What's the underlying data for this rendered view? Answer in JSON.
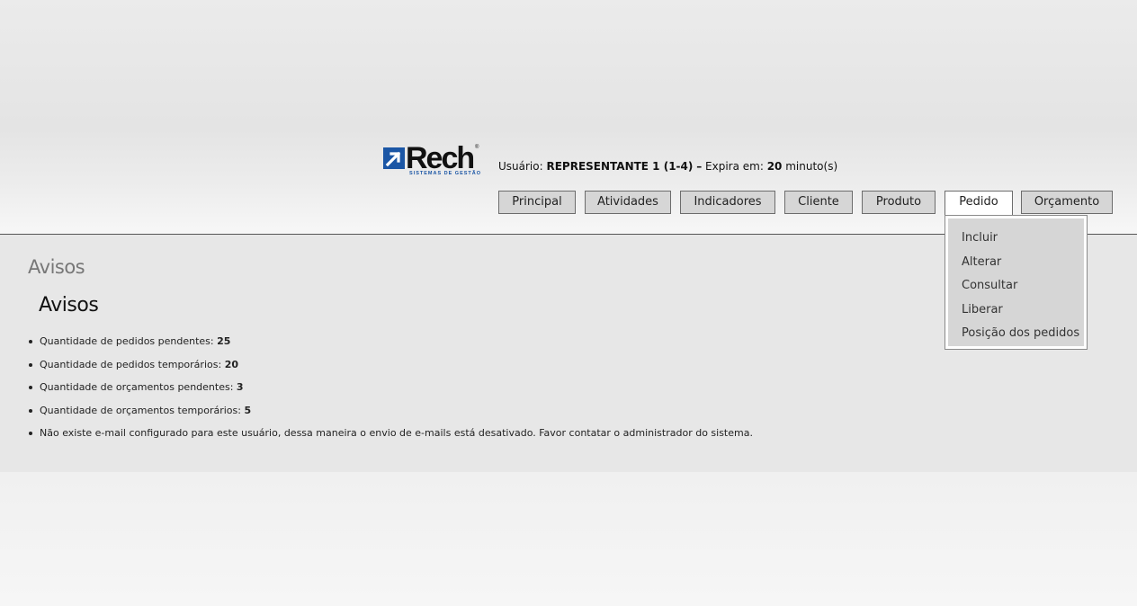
{
  "logo": {
    "wordmark": "Rech",
    "registered": "®",
    "tagline": "SISTEMAS DE GESTÃO"
  },
  "user_info": {
    "user_label": "Usuário:",
    "user_name": "REPRESENTANTE 1 (1-4)",
    "separator": "–",
    "expires_label": "Expira em:",
    "expires_value": "20",
    "expires_unit": "minuto(s)"
  },
  "nav": {
    "items": [
      {
        "label": "Principal"
      },
      {
        "label": "Atividades"
      },
      {
        "label": "Indicadores"
      },
      {
        "label": "Cliente"
      },
      {
        "label": "Produto"
      },
      {
        "label": "Pedido"
      },
      {
        "label": "Orçamento"
      }
    ],
    "active": "Pedido"
  },
  "dropdown": {
    "items": [
      {
        "label": "Incluir"
      },
      {
        "label": "Alterar"
      },
      {
        "label": "Consultar"
      },
      {
        "label": "Liberar"
      },
      {
        "label": "Posição dos pedidos"
      }
    ]
  },
  "page": {
    "title": "Avisos",
    "section_title": "Avisos"
  },
  "notices": [
    {
      "text": "Quantidade de pedidos pendentes:",
      "value": "25"
    },
    {
      "text": "Quantidade de pedidos temporários:",
      "value": "20"
    },
    {
      "text": "Quantidade de orçamentos pendentes:",
      "value": "3"
    },
    {
      "text": "Quantidade de orçamentos temporários:",
      "value": "5"
    },
    {
      "text": "Não existe e-mail configurado para este usuário, dessa maneira o envio de e-mails está desativado. Favor contatar o administrador do sistema.",
      "value": ""
    }
  ],
  "colors": {
    "brand_blue": "#1b56a5",
    "nav_button_bg": "#d6d6d6",
    "content_bg": "#e7e7e7"
  }
}
